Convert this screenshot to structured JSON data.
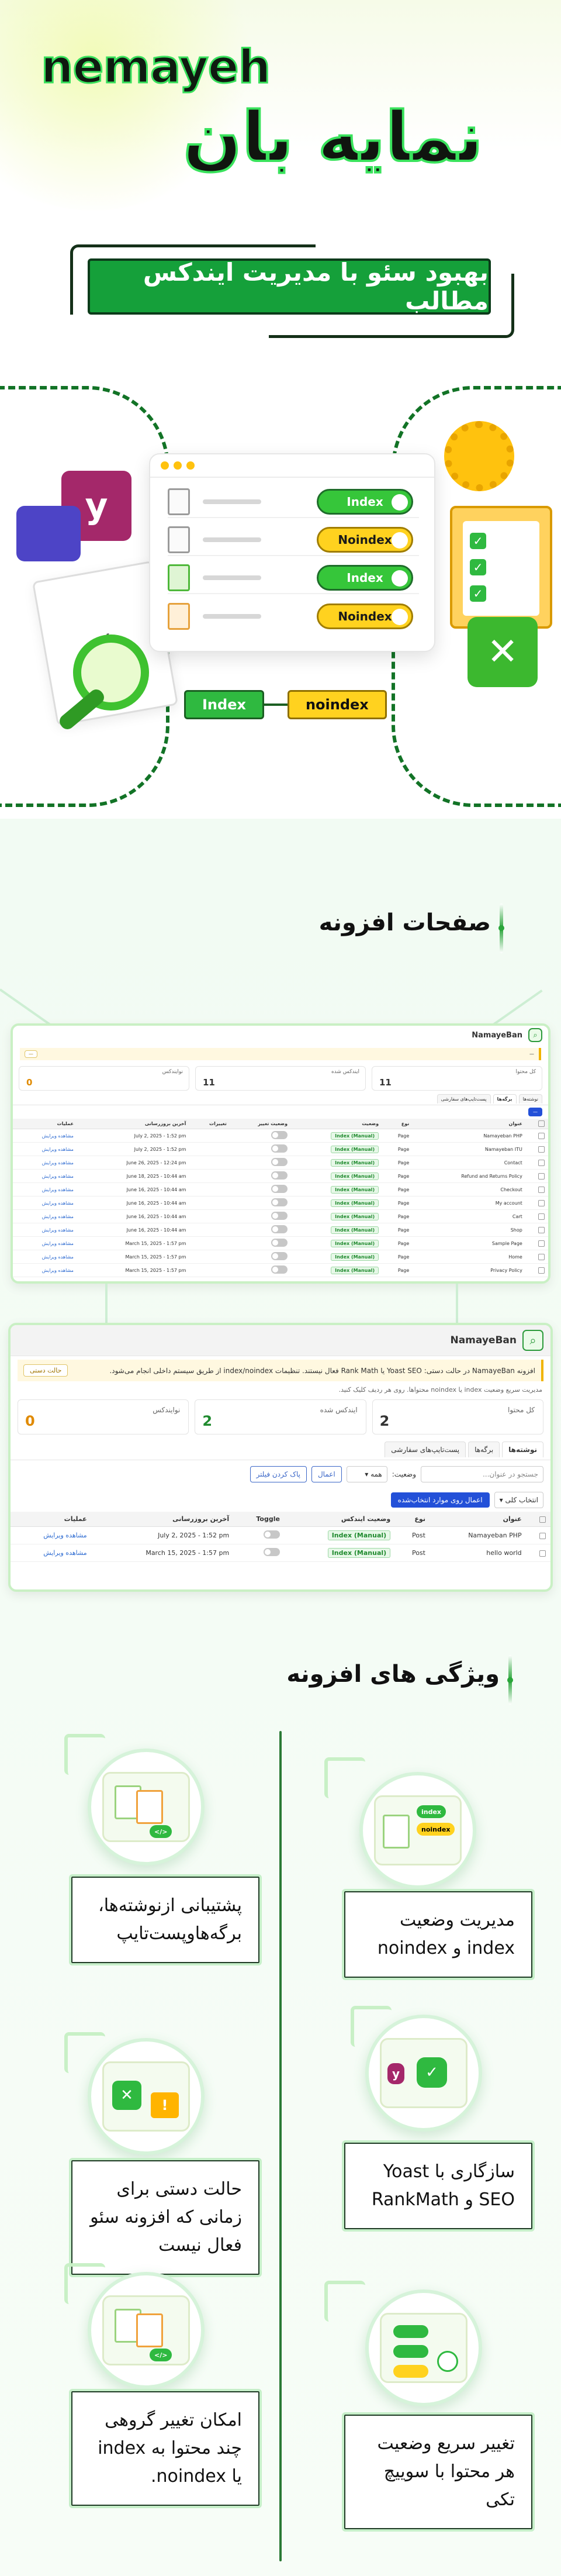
{
  "hero": {
    "brand_latin": "nemayeh",
    "brand_persian": "نمایه بان",
    "tagline": "بهبود سئو با مدیریت ایندکس مطالب"
  },
  "illustration": {
    "rows": [
      "Index",
      "Noindex",
      "Index",
      "Noindex"
    ],
    "flow_from": "Index",
    "flow_to": "noindex",
    "code_glyph": "</>"
  },
  "section_pages": {
    "title": "صفحات افزونه"
  },
  "screenshot1": {
    "plugin_name": "NamayeBan",
    "stats": [
      {
        "label": "کل محتوا",
        "value": "11"
      },
      {
        "label": "ایندکس شده",
        "value": "11"
      },
      {
        "label": "نوایندکس",
        "value": "0"
      }
    ],
    "tabs": [
      "نوشته‌ها",
      "برگه‌ها",
      "پست‌تایپ‌های سفارشی"
    ],
    "columns": [
      "عنوان",
      "نوع",
      "وضعیت",
      "وضعیت تغییر",
      "تغییرات",
      "آخرین بروزرسانی",
      "عملیات"
    ],
    "rows": [
      {
        "title": "Namayeban PHP",
        "type": "Page",
        "status": "Index (Manual)",
        "date": "July 2, 2025 - 1:52 pm"
      },
      {
        "title": "Namayeban ITU",
        "type": "Page",
        "status": "Index (Manual)",
        "date": "July 2, 2025 - 1:52 pm"
      },
      {
        "title": "Contact",
        "type": "Page",
        "status": "Index (Manual)",
        "date": "June 26, 2025 - 12:24 pm"
      },
      {
        "title": "Refund and Returns Policy",
        "type": "Page",
        "status": "Index (Manual)",
        "date": "June 18, 2025 - 10:44 am"
      },
      {
        "title": "Checkout",
        "type": "Page",
        "status": "Index (Manual)",
        "date": "June 16, 2025 - 10:44 am"
      },
      {
        "title": "My account",
        "type": "Page",
        "status": "Index (Manual)",
        "date": "June 16, 2025 - 10:44 am"
      },
      {
        "title": "Cart",
        "type": "Page",
        "status": "Index (Manual)",
        "date": "June 16, 2025 - 10:44 am"
      },
      {
        "title": "Shop",
        "type": "Page",
        "status": "Index (Manual)",
        "date": "June 16, 2025 - 10:44 am"
      },
      {
        "title": "Sample Page",
        "type": "Page",
        "status": "Index (Manual)",
        "date": "March 15, 2025 - 1:57 pm"
      },
      {
        "title": "Home",
        "type": "Page",
        "status": "Index (Manual)",
        "date": "March 15, 2025 - 1:57 pm"
      },
      {
        "title": "Privacy Policy",
        "type": "Page",
        "status": "Index (Manual)",
        "date": "March 15, 2025 - 1:57 pm"
      }
    ],
    "row_action": "مشاهده  ویرایش"
  },
  "screenshot2": {
    "plugin_name": "NamayeBan",
    "notice": "افزونه NamayeBan در حالت دستی: Yoast SEO یا Rank Math فعال نیستند. تنظیمات index/noindex از طریق سیستم داخلی انجام می‌شود.",
    "notice_button": "حالت دستی",
    "hint": "مدیریت سریع وضعیت index یا noindex محتواها. روی هر ردیف کلیک کنید.",
    "stats": [
      {
        "label": "کل محتوا",
        "value": "2"
      },
      {
        "label": "ایندکس شده",
        "value": "2"
      },
      {
        "label": "نوایندکس",
        "value": "0"
      }
    ],
    "tabs": [
      "نوشته‌ها",
      "برگه‌ها",
      "پست‌تایپ‌های سفارشی"
    ],
    "search_placeholder": "جستجو در عنوان...",
    "status_label": "وضعیت:",
    "status_value": "همه",
    "apply": "اعمال",
    "reset": "پاک کردن فیلتر",
    "bulk_select": "انتخاب کلی",
    "bulk_apply": "اعمال روی موارد انتخاب‌شده",
    "columns": [
      "عنوان",
      "نوع",
      "وضعیت ایندکس",
      "Toggle",
      "آخرین بروزرسانی",
      "عملیات"
    ],
    "rows": [
      {
        "title": "Namayeban PHP",
        "type": "Post",
        "status": "Index (Manual)",
        "date": "July 2, 2025 - 1:52 pm"
      },
      {
        "title": "hello world",
        "type": "Post",
        "status": "Index (Manual)",
        "date": "March 15, 2025 - 1:57 pm"
      }
    ],
    "row_action": "مشاهده  ویرایش"
  },
  "section_features": {
    "title": "ویژگی های افزونه"
  },
  "features": [
    {
      "text": "مدیریت وضعیت index و noindex"
    },
    {
      "text": "پشتیبانی ازنوشته‌ها، برگه‌هاوپست‌تایپ"
    },
    {
      "text": "سازگاری با Yoast SEO و RankMath"
    },
    {
      "text": "حالت دستی برای زمانی که افزونه سئو فعال نیست"
    },
    {
      "text": "تغییر سریع وضعیت هر محتوا با سوییچ تکی"
    },
    {
      "text": "امکان تغییر گروهی چند محتوا به index یا noindex."
    }
  ],
  "colors": {
    "green": "#15a03a",
    "dark": "#10150f",
    "yellow": "#ffd21f",
    "accent": "#39e25c"
  }
}
